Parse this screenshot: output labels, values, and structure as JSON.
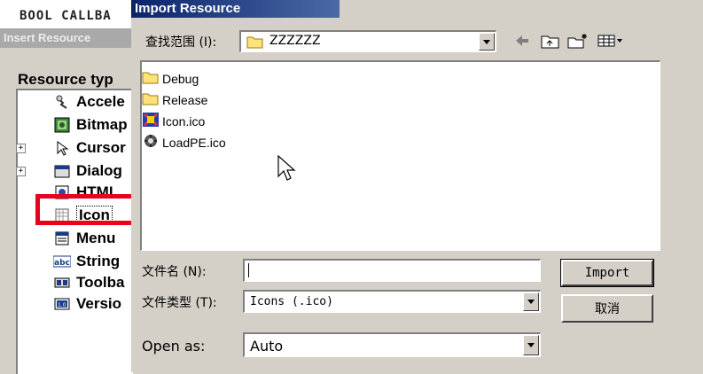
{
  "background_code": {
    "text": "BOOL CALLBA"
  },
  "insert_dialog": {
    "title": "Insert Resource",
    "resource_type_label": "Resource typ",
    "tree_items": [
      {
        "label": "Accele",
        "icon": "accelerator-icon",
        "expandable": false
      },
      {
        "label": "Bitmap",
        "icon": "bitmap-icon",
        "expandable": false
      },
      {
        "label": "Cursor",
        "icon": "cursor-icon",
        "expandable": true
      },
      {
        "label": "Dialog",
        "icon": "dialog-icon",
        "expandable": true
      },
      {
        "label": "HTML",
        "icon": "html-icon",
        "expandable": false
      },
      {
        "label": "Icon",
        "icon": "icon-resource-icon",
        "expandable": false,
        "selected": true
      },
      {
        "label": "Menu",
        "icon": "menu-icon",
        "expandable": false
      },
      {
        "label": "String",
        "icon": "string-table-icon",
        "expandable": false
      },
      {
        "label": "Toolba",
        "icon": "toolbar-icon",
        "expandable": false
      },
      {
        "label": "Versio",
        "icon": "version-icon",
        "expandable": false
      }
    ]
  },
  "import_dialog": {
    "title": "Import Resource",
    "look_in_label": "查找范围 (I):",
    "look_in_value": "ZZZZZZ",
    "toolbar": [
      "back-arrow-icon",
      "up-folder-icon",
      "new-folder-icon",
      "view-menu-icon"
    ],
    "files": [
      {
        "name": "Debug",
        "icon": "folder-icon"
      },
      {
        "name": "Release",
        "icon": "folder-icon"
      },
      {
        "name": "Icon.ico",
        "icon": "ico-file-icon"
      },
      {
        "name": "LoadPE.ico",
        "icon": "loadpe-ico-icon"
      }
    ],
    "filename_label": "文件名 (N):",
    "filename_value": "",
    "filetype_label": "文件类型 (T):",
    "filetype_value": "Icons (.ico)",
    "open_as_label": "Open as:",
    "open_as_value": "Auto",
    "import_button": "Import",
    "cancel_button": "取消"
  },
  "colors": {
    "title_bar": "#0a246a",
    "highlight_box": "#e8001c",
    "dialog_face": "#d4d0c8",
    "blue_window": "#a6caf0"
  }
}
